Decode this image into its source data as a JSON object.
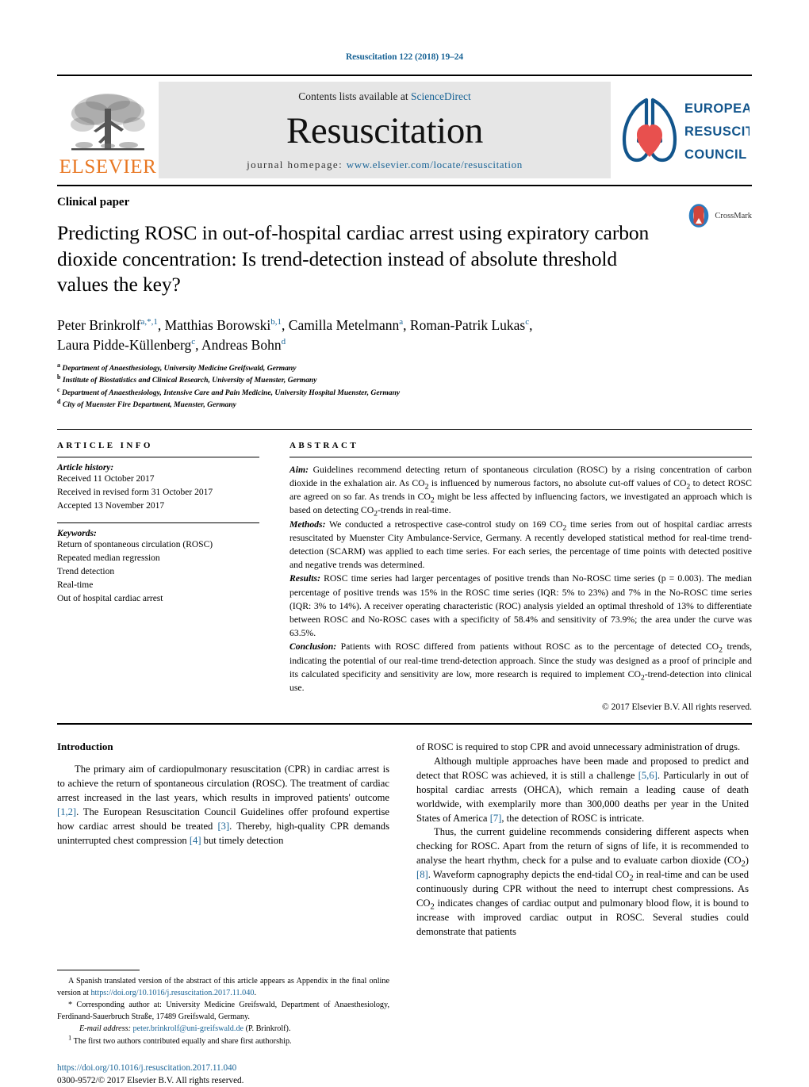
{
  "running_head": "Resuscitation 122 (2018) 19–24",
  "masthead": {
    "contents_prefix": "Contents lists available at ",
    "contents_link": "ScienceDirect",
    "journal_title": "Resuscitation",
    "homepage_prefix": "journal homepage: ",
    "homepage_url": "www.elsevier.com/locate/resuscitation",
    "publisher_logo_word": "ELSEVIER",
    "society_logo_lines": [
      "EUROPEAN",
      "RESUSCITATION",
      "COUNCIL"
    ]
  },
  "article": {
    "kicker": "Clinical paper",
    "title": "Predicting ROSC in out-of-hospital cardiac arrest using expiratory carbon dioxide concentration: Is trend-detection instead of absolute threshold values the key?",
    "crossmark_label": "CrossMark",
    "authors_line_1": "Peter Brinkrolf<sup>a,*,1</sup>, Matthias Borowski<sup>b,1</sup>, Camilla Metelmann<sup>a</sup>, Roman-Patrik Lukas<sup>c</sup>,",
    "authors_line_2": "Laura Pidde-Küllenberg<sup>c</sup>, Andreas Bohn<sup>d</sup>",
    "affiliations": [
      "<sup>a</sup> Department of Anaesthesiology, University Medicine Greifswald, Germany",
      "<sup>b</sup> Institute of Biostatistics and Clinical Research, University of Muenster, Germany",
      "<sup>c</sup> Department of Anaesthesiology, Intensive Care and Pain Medicine, University Hospital Muenster, Germany",
      "<sup>d</sup> City of Muenster Fire Department, Muenster, Germany"
    ]
  },
  "article_info": {
    "heading": "ARTICLE INFO",
    "history_label": "Article history:",
    "history": [
      "Received 11 October 2017",
      "Received in revised form 31 October 2017",
      "Accepted 13 November 2017"
    ],
    "keywords_label": "Keywords:",
    "keywords": [
      "Return of spontaneous circulation (ROSC)",
      "Repeated median regression",
      "Trend detection",
      "Real-time",
      "Out of hospital cardiac arrest"
    ]
  },
  "abstract": {
    "heading": "ABSTRACT",
    "aim_label": "Aim:",
    "aim_text": " Guidelines recommend detecting return of spontaneous circulation (ROSC) by a rising concentration of carbon dioxide in the exhalation air. As CO<sub>2</sub> is influenced by numerous factors, no absolute cut-off values of CO<sub>2</sub> to detect ROSC are agreed on so far. As trends in CO<sub>2</sub> might be less affected by influencing factors, we investigated an approach which is based on detecting CO<sub>2</sub>-trends in real-time.",
    "methods_label": "Methods:",
    "methods_text": " We conducted a retrospective case-control study on 169 CO<sub>2</sub> time series from out of hospital cardiac arrests resuscitated by Muenster City Ambulance-Service, Germany. A recently developed statistical method for real-time trend-detection (SCARM) was applied to each time series. For each series, the percentage of time points with detected positive and negative trends was determined.",
    "results_label": "Results:",
    "results_text": " ROSC time series had larger percentages of positive trends than No-ROSC time series (p = 0.003). The median percentage of positive trends was 15% in the ROSC time series (IQR: 5% to 23%) and 7% in the No-ROSC time series (IQR: 3% to 14%). A receiver operating characteristic (ROC) analysis yielded an optimal threshold of 13% to differentiate between ROSC and No-ROSC cases with a specificity of 58.4% and sensitivity of 73.9%; the area under the curve was 63.5%.",
    "conclusion_label": "Conclusion:",
    "conclusion_text": " Patients with ROSC differed from patients without ROSC as to the percentage of detected CO<sub>2</sub> trends, indicating the potential of our real-time trend-detection approach. Since the study was designed as a proof of principle and its calculated specificity and sensitivity are low, more research is required to implement CO<sub>2</sub>-trend-detection into clinical use.",
    "copyright": "© 2017 Elsevier B.V. All rights reserved."
  },
  "introduction": {
    "heading": "Introduction",
    "left_p1": "The primary aim of cardiopulmonary resuscitation (CPR) in cardiac arrest is to achieve the return of spontaneous circulation (ROSC). The treatment of cardiac arrest increased in the last years, which results in improved patients' outcome <span class=\"ref\">[1,2]</span>. The European Resuscitation Council Guidelines offer profound expertise how cardiac arrest should be treated <span class=\"ref\">[3]</span>. Thereby, high-quality CPR demands uninterrupted chest compression <span class=\"ref\">[4]</span> but timely detection",
    "right_p1": "of ROSC is required to stop CPR and avoid unnecessary administration of drugs.",
    "right_p2": "Although multiple approaches have been made and proposed to predict and detect that ROSC was achieved, it is still a challenge <span class=\"ref\">[5,6]</span>. Particularly in out of hospital cardiac arrests (OHCA), which remain a leading cause of death worldwide, with exemplarily more than 300,000 deaths per year in the United States of America <span class=\"ref\">[7]</span>, the detection of ROSC is intricate.",
    "right_p3": "Thus, the current guideline recommends considering different aspects when checking for ROSC. Apart from the return of signs of life, it is recommended to analyse the heart rhythm, check for a pulse and to evaluate carbon dioxide (CO<sub>2</sub>) <span class=\"ref\">[8]</span>. Waveform capnography depicts the end-tidal CO<sub>2</sub> in real-time and can be used continuously during CPR without the need to interrupt chest compressions. As CO<sub>2</sub> indicates changes of cardiac output and pulmonary blood flow, it is bound to increase with improved cardiac output in ROSC. Several studies could demonstrate that patients"
  },
  "footnotes": {
    "appendix_note": "A Spanish translated version of the abstract of this article appears as Appendix in the final online version at <span class=\"link\">https://doi.org/10.1016/j.resuscitation.2017.11.040</span>.",
    "corresponding": "* Corresponding author at: University Medicine Greifswald, Department of Anaesthesiology, Ferdinand-Sauerbruch Straße, 17489 Greifswald, Germany.",
    "email_label": "E-mail address:",
    "email_value": "peter.brinkrolf@uni-greifswald.de",
    "email_suffix": " (P. Brinkrolf).",
    "equal_contrib": "<sup>1</sup> The first two authors contributed equally and share first authorship.",
    "doi_url": "https://doi.org/10.1016/j.resuscitation.2017.11.040",
    "issn_line": "0300-9572/© 2017 Elsevier B.V. All rights reserved."
  },
  "colors": {
    "link": "#1a6496",
    "elsevier_orange": "#e87722",
    "erc_blue": "#12558c",
    "erc_red": "#e8504e",
    "band_gray": "#e6e6e6"
  }
}
